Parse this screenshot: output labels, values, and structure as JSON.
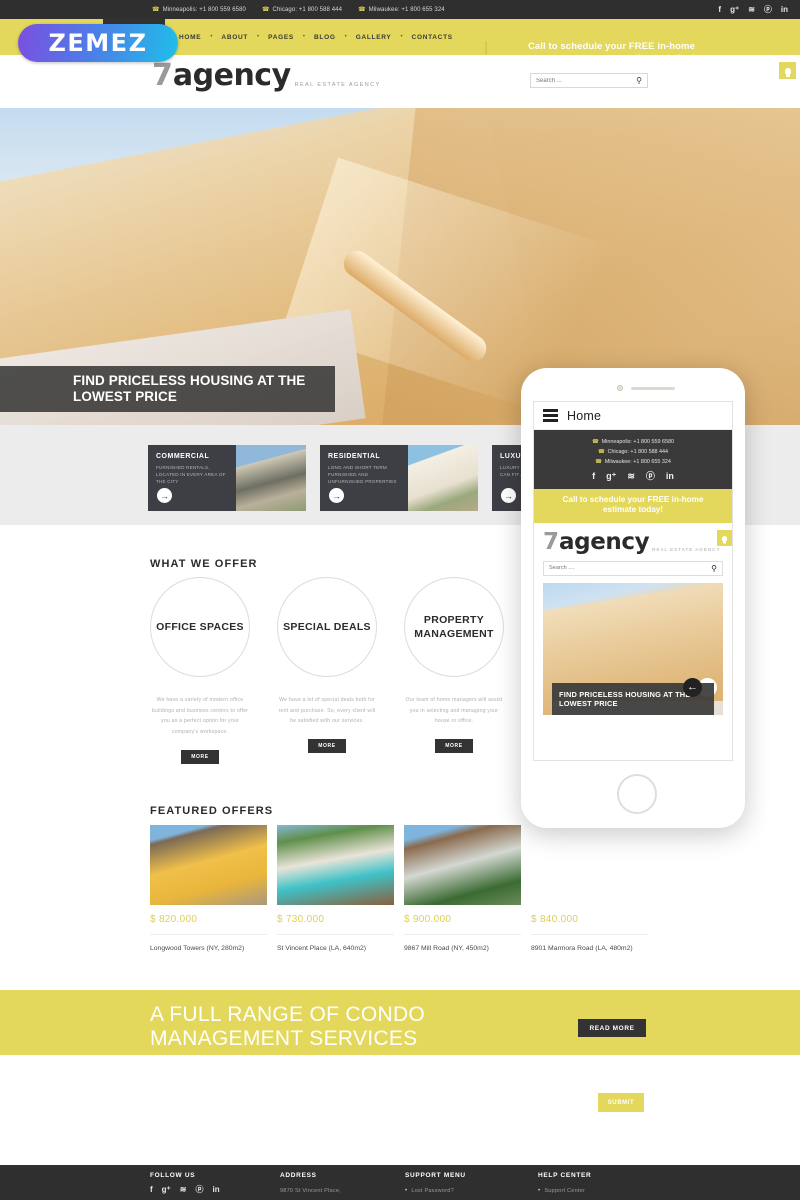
{
  "topbar": {
    "phones": [
      {
        "city_label": "Minneapolis:",
        "number": "+1 800 559 6580",
        "full": "Minneapolis: +1 800 559 6580"
      },
      {
        "city_label": "Chicago:",
        "number": "+1 800 588 444",
        "full": "Chicago: +1 800 588 444"
      },
      {
        "city_label": "Milwaukee:",
        "number": "+1 800 655 324",
        "full": "Milwaukee: +1 800 655 324"
      }
    ],
    "social": [
      {
        "name": "facebook-icon",
        "glyph": "f"
      },
      {
        "name": "google-plus-icon",
        "glyph": "g⁺"
      },
      {
        "name": "rss-icon",
        "glyph": "≋"
      },
      {
        "name": "pinterest-icon",
        "glyph": "ⓟ"
      },
      {
        "name": "linkedin-icon",
        "glyph": "in"
      }
    ]
  },
  "nav": {
    "items": [
      "HOME",
      "ABOUT",
      "PAGES",
      "BLOG",
      "GALLERY",
      "CONTACTS"
    ],
    "separator": "•",
    "cta": "Call to schedule your FREE in-home estimate today!"
  },
  "zemez": {
    "label": "ZEMEZ"
  },
  "brand": {
    "mark_number": "7",
    "mark_word": "agency",
    "tagline": "REAL ESTATE AGENCY"
  },
  "search": {
    "placeholder": "Search ...",
    "value": "",
    "icon": "🔍"
  },
  "hero": {
    "caption": "FIND PRICELESS HOUSING AT THE LOWEST PRICE"
  },
  "categories": [
    {
      "title": "COMMERCIAL",
      "desc": "FURNISHED RENTALS, LOCATED IN EVERY AREA OF THE CITY",
      "arrow": "→"
    },
    {
      "title": "RESIDENTIAL",
      "desc": "LONG AND SHORT TERM FURNISHED AND UNFURNISHED PROPERTIES",
      "arrow": "→"
    },
    {
      "title": "LUXURY",
      "desc": "LUXURY APARTMENTS THAT CAN FIT ANY LIFESTYLE",
      "arrow": "→"
    }
  ],
  "offers_section": {
    "title": "WHAT WE OFFER",
    "items": [
      {
        "title": "OFFICE SPACES",
        "desc": "We have a variety of modern office buildings and business centers to offer you as a perfect option for your company's workspace.",
        "button": "MORE"
      },
      {
        "title": "SPECIAL DEALS",
        "desc": "We have a lot of special deals both for rent and purchase. So, every client will be satisfied with our services.",
        "button": "MORE"
      },
      {
        "title": "PROPERTY MANAGEMENT",
        "desc": "Our team of home managers will assist you in selecting and managing your house or office.",
        "button": "MORE"
      }
    ]
  },
  "featured_section": {
    "title": "FEATURED OFFERS",
    "items": [
      {
        "price": "$ 820.000",
        "name": "Longwood Towers (NY, 280m2)"
      },
      {
        "price": "$ 730.000",
        "name": "St Vincent Place (LA, 640m2)"
      },
      {
        "price": "$ 900.000",
        "name": "9867 Mill Road (NY, 450m2)"
      },
      {
        "price": "$ 840.000",
        "name": "8901 Marmora Road (LA, 480m2)"
      }
    ]
  },
  "band": {
    "title": "A FULL RANGE OF CONDO MANAGEMENT SERVICES",
    "button": "READ MORE"
  },
  "form": {
    "submit": "SUBMIT"
  },
  "footer": {
    "columns": [
      {
        "heading": "FOLLOW US",
        "body": ""
      },
      {
        "heading": "ADDRESS",
        "body": "9870 St Vincent Place,"
      },
      {
        "heading": "SUPPORT MENU",
        "body": "Lost Password?"
      },
      {
        "heading": "HELP CENTER",
        "body": "Support Center"
      }
    ],
    "social": [
      {
        "name": "facebook-icon",
        "glyph": "f"
      },
      {
        "name": "google-plus-icon",
        "glyph": "g⁺"
      },
      {
        "name": "rss-icon",
        "glyph": "≋"
      },
      {
        "name": "pinterest-icon",
        "glyph": "ⓟ"
      },
      {
        "name": "linkedin-icon",
        "glyph": "in"
      }
    ]
  },
  "phone_mockup": {
    "menu_label": "Home",
    "phones": [
      "Minneapolis: +1 800 559 6580",
      "Chicago: +1 800 588 444",
      "Milwaukee: +1 800 655 324"
    ],
    "social": [
      {
        "name": "facebook-icon",
        "glyph": "f"
      },
      {
        "name": "google-plus-icon",
        "glyph": "g⁺"
      },
      {
        "name": "rss-icon",
        "glyph": "≋"
      },
      {
        "name": "pinterest-icon",
        "glyph": "ⓟ"
      },
      {
        "name": "linkedin-icon",
        "glyph": "in"
      }
    ],
    "cta": "Call to schedule your FREE in-home estimate today!",
    "brand_number": "7",
    "brand_word": "agency",
    "brand_tagline": "REAL ESTATE AGENCY",
    "search_placeholder": "Search ....",
    "slide_caption": "FIND PRICELESS HOUSING AT THE LOWEST PRICE",
    "prev_arrow": "←",
    "next_arrow": "→"
  },
  "colors": {
    "accent_yellow": "#e3d85c",
    "dark": "#2f2f2f",
    "card_dark": "#3d3f44",
    "price_yellow": "#ddcf56"
  }
}
